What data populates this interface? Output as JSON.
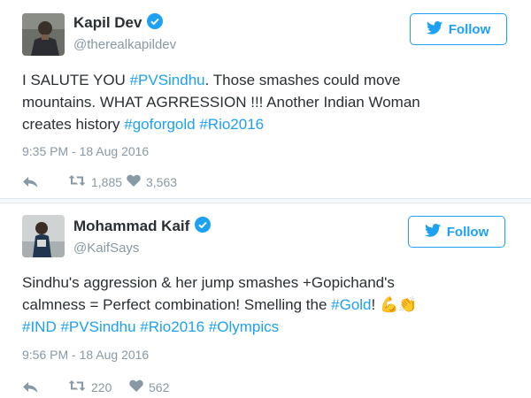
{
  "tweets": [
    {
      "name": "Kapil Dev",
      "handle": "@therealkapildev",
      "follow_label": "Follow",
      "lines": [
        [
          {
            "t": "I SALUTE YOU "
          },
          {
            "t": "#PVSindhu",
            "tag": true
          },
          {
            "t": ". Those smashes could move"
          }
        ],
        [
          {
            "t": "mountains. WHAT AGRRESSION !!! Another Indian Woman"
          }
        ],
        [
          {
            "t": "creates history "
          },
          {
            "t": "#goforgold",
            "tag": true
          },
          {
            "t": " "
          },
          {
            "t": "#Rio2016",
            "tag": true
          }
        ]
      ],
      "timestamp": "9:35 PM - 18 Aug 2016",
      "retweets": "1,885",
      "likes": "3,563"
    },
    {
      "name": "Mohammad Kaif",
      "handle": "@KaifSays",
      "follow_label": "Follow",
      "lines": [
        [
          {
            "t": "Sindhu's aggression & her jump smashes +Gopichand's"
          }
        ],
        [
          {
            "t": "calmness = Perfect combination! Smelling the "
          },
          {
            "t": "#Gold",
            "tag": true
          },
          {
            "t": "! "
          },
          {
            "t": "💪👏",
            "emoji": true
          }
        ],
        [
          {
            "t": "#IND",
            "tag": true
          },
          {
            "t": " "
          },
          {
            "t": "#PVSindhu",
            "tag": true
          },
          {
            "t": " "
          },
          {
            "t": "#Rio2016",
            "tag": true
          },
          {
            "t": " "
          },
          {
            "t": "#Olympics",
            "tag": true
          }
        ]
      ],
      "timestamp": "9:56 PM - 18 Aug 2016",
      "retweets": "220",
      "likes": "562"
    }
  ],
  "colors": {
    "link": "#1da1f2",
    "muted": "#8899a6",
    "text": "#292f33"
  },
  "icons": [
    "verified-badge-icon",
    "twitter-bird-icon",
    "reply-icon",
    "retweet-icon",
    "like-icon"
  ]
}
